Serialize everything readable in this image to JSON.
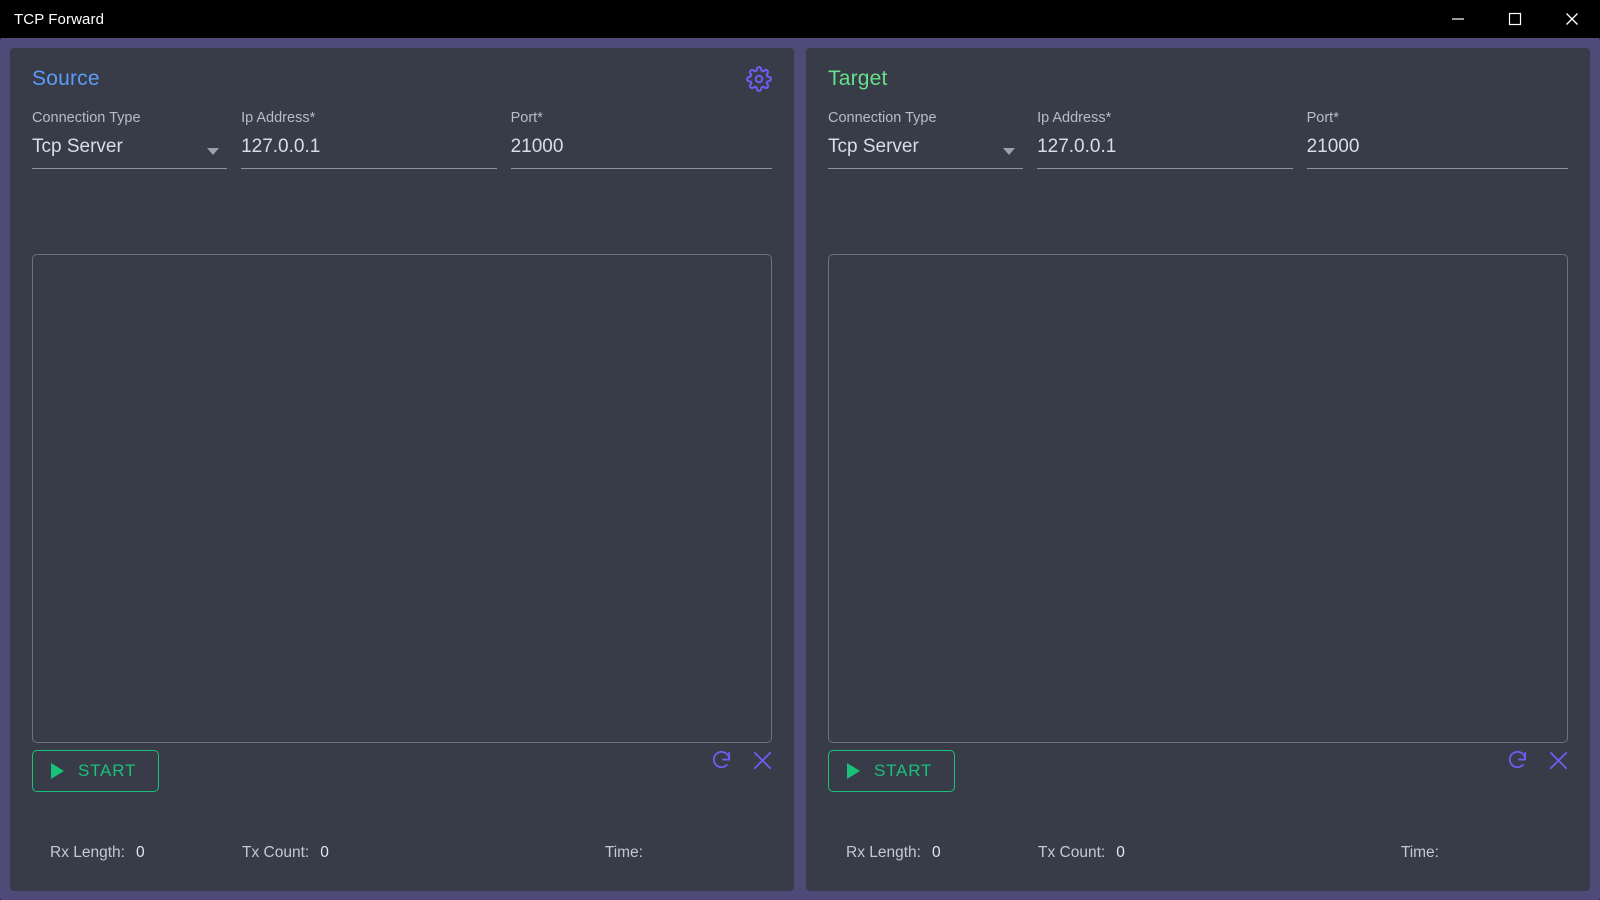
{
  "window": {
    "title": "TCP Forward",
    "controls": [
      {
        "name": "minimize",
        "label": "—"
      },
      {
        "name": "maximize",
        "label": "☐"
      },
      {
        "name": "close",
        "label": "✕"
      }
    ]
  },
  "colors": {
    "accent_purple": "#6a5ff0",
    "frame_purple": "#4f4a78",
    "panel_bg": "#383b48",
    "source_title": "#5b9cf8",
    "target_title": "#66e08a",
    "start_green": "#18c278",
    "titlebar_bg": "#000000",
    "label_text": "#b8bcc8",
    "value_text": "#d9dde6"
  },
  "panels": [
    {
      "id": "source",
      "title": "Source",
      "has_settings": true,
      "settings_icon": "gear-icon",
      "fields": {
        "connection_type": {
          "label": "Connection Type",
          "value": "Tcp Server",
          "icon": "chevron-down-icon"
        },
        "ip_address": {
          "label": "Ip Address*",
          "value": "127.0.0.1",
          "placeholder": "Ip Address"
        },
        "port": {
          "label": "Port*",
          "value": "21000",
          "placeholder": "Port"
        }
      },
      "log": {
        "content": ""
      },
      "start_button": {
        "label": "START",
        "icon": "play-icon"
      },
      "icon_actions": [
        {
          "name": "refresh-icon",
          "label": "Refresh"
        },
        {
          "name": "close-icon",
          "label": "Clear"
        }
      ],
      "status": {
        "rx_label": "Rx Length:",
        "rx_value": "0",
        "tx_label": "Tx Count:",
        "tx_value": "0",
        "time_label": "Time:",
        "time_value": ""
      }
    },
    {
      "id": "target",
      "title": "Target",
      "has_settings": false,
      "settings_icon": "",
      "fields": {
        "connection_type": {
          "label": "Connection Type",
          "value": "Tcp Server",
          "icon": "chevron-down-icon"
        },
        "ip_address": {
          "label": "Ip Address*",
          "value": "127.0.0.1",
          "placeholder": "Ip Address"
        },
        "port": {
          "label": "Port*",
          "value": "21000",
          "placeholder": "Port"
        }
      },
      "log": {
        "content": ""
      },
      "start_button": {
        "label": "START",
        "icon": "play-icon"
      },
      "icon_actions": [
        {
          "name": "refresh-icon",
          "label": "Refresh"
        },
        {
          "name": "close-icon",
          "label": "Clear"
        }
      ],
      "status": {
        "rx_label": "Rx Length:",
        "rx_value": "0",
        "tx_label": "Tx Count:",
        "tx_value": "0",
        "time_label": "Time:",
        "time_value": ""
      }
    }
  ]
}
